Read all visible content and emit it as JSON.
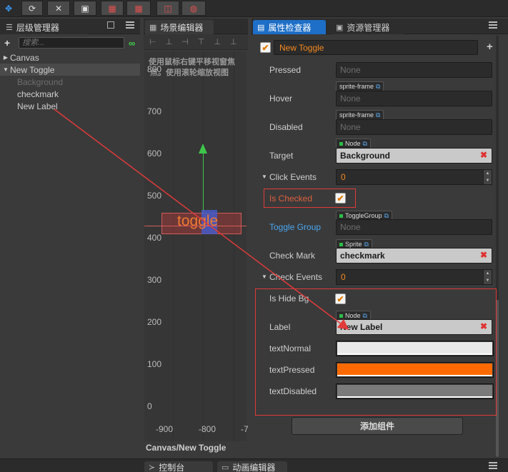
{
  "toolbar": {
    "buttons": [
      "✥",
      "⟳",
      "✕",
      "▣",
      "▦",
      "▦",
      "◫",
      "◍"
    ]
  },
  "hierarchy": {
    "tab_label": "层级管理器",
    "add_label": "+",
    "search_placeholder": "搜索...",
    "nodes": [
      {
        "label": "Canvas",
        "caret": "▶",
        "color": "#cfcfcf",
        "indent": 0
      },
      {
        "label": "New Toggle",
        "caret": "▼",
        "color": "#cfcfcf",
        "indent": 0,
        "selected": true
      },
      {
        "label": "Background",
        "caret": "",
        "color": "#6d6d6d",
        "indent": 1
      },
      {
        "label": "checkmark",
        "caret": "",
        "color": "#cfcfcf",
        "indent": 1
      },
      {
        "label": "New Label",
        "caret": "",
        "color": "#cfcfcf",
        "indent": 1
      }
    ]
  },
  "scene": {
    "tab_label": "场景编辑器",
    "hint_line1": "使用鼠标右键平移视窗焦",
    "hint_line2": "点。使用滚轮缩放视图",
    "y_labels": [
      "800",
      "700",
      "600",
      "500",
      "400",
      "300",
      "200",
      "100",
      "0"
    ],
    "x_labels": [
      "-900",
      "-800",
      "-7"
    ],
    "toggle_text": "toggle",
    "breadcrumb": "Canvas/New Toggle"
  },
  "inspector": {
    "tab_label": "属性检查器",
    "assets_tab_label": "资源管理器",
    "node_name": "New Toggle",
    "add_icon": "+",
    "rows": {
      "pressed": {
        "label": "Pressed",
        "value": "None"
      },
      "hover": {
        "label": "Hover",
        "tag": "sprite-frame",
        "value": "None"
      },
      "disabled": {
        "label": "Disabled",
        "tag": "sprite-frame",
        "value": "None"
      },
      "target": {
        "label": "Target",
        "tag": "Node",
        "value": "Background"
      },
      "click_events": {
        "label": "Click Events",
        "value": "0"
      },
      "is_checked": {
        "label": "Is Checked"
      },
      "toggle_group": {
        "label": "Toggle Group",
        "tag": "ToggleGroup",
        "value": "None"
      },
      "check_mark": {
        "label": "Check Mark",
        "tag": "Sprite",
        "value": "checkmark"
      },
      "check_events": {
        "label": "Check Events",
        "value": "0"
      },
      "is_hide_bg": {
        "label": "Is Hide Bg"
      },
      "label": {
        "label": "Label",
        "tag": "Node",
        "value": "New Label"
      },
      "text_normal": {
        "label": "textNormal",
        "color": "#e8e8e8"
      },
      "text_pressed": {
        "label": "textPressed",
        "color": "#ff6a00"
      },
      "text_disabled": {
        "label": "textDisabled",
        "color": "#7a7a7a"
      }
    },
    "add_component_label": "添加组件"
  },
  "bottom": {
    "console_tab": "控制台",
    "animation_tab": "动画编辑器"
  },
  "colors": {
    "accent": "#1e6fc7",
    "annotation": "#e03a3a"
  }
}
